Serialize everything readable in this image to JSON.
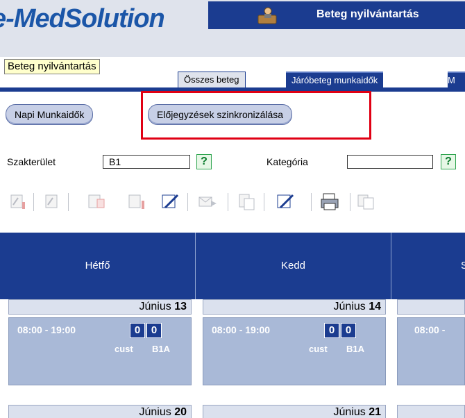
{
  "header": {
    "logo_text": "e-MedSolution",
    "module_title": "Beteg nyilvántartás"
  },
  "module_label": "Beteg nyilvántartás",
  "tabs": [
    {
      "label": "Összes beteg",
      "active": false
    },
    {
      "label": "Járóbeteg munkaidők",
      "active": true
    },
    {
      "label": "M",
      "active": false
    }
  ],
  "actions": {
    "napi_label": "Napi Munkaidők",
    "sync_label": "Előjegyzések szinkronizálása"
  },
  "filters": {
    "szakterulet_label": "Szakterület",
    "szakterulet_value": "B1",
    "kategoria_label": "Kategória",
    "kategoria_value": "",
    "help_glyph": "?"
  },
  "toolbar": {
    "icons": [
      "edit-icon",
      "edit-icon",
      "copy-icon",
      "edit-pen-icon",
      "mail-icon",
      "paste-icon",
      "edit-pen-icon",
      "print-icon",
      "copy-icon"
    ]
  },
  "calendar": {
    "days": [
      {
        "name": "Hétfő"
      },
      {
        "name": "Kedd"
      },
      {
        "name": "S"
      }
    ],
    "week1": [
      {
        "month": "Június",
        "day": "13",
        "time": "08:00 - 19:00",
        "count_a": "0",
        "count_b": "0",
        "user": "cust",
        "room": "B1A"
      },
      {
        "month": "Június",
        "day": "14",
        "time": "08:00 - 19:00",
        "count_a": "0",
        "count_b": "0",
        "user": "cust",
        "room": "B1A"
      },
      {
        "month": "",
        "day": "",
        "time": "08:00 -",
        "count_a": "",
        "count_b": "",
        "user": "",
        "room": ""
      }
    ],
    "week2": [
      {
        "month": "Június",
        "day": "20"
      },
      {
        "month": "Június",
        "day": "21"
      }
    ]
  },
  "colors": {
    "accent": "#1b3c90",
    "highlight": "#e00014",
    "slot": "#a9b9d7"
  }
}
